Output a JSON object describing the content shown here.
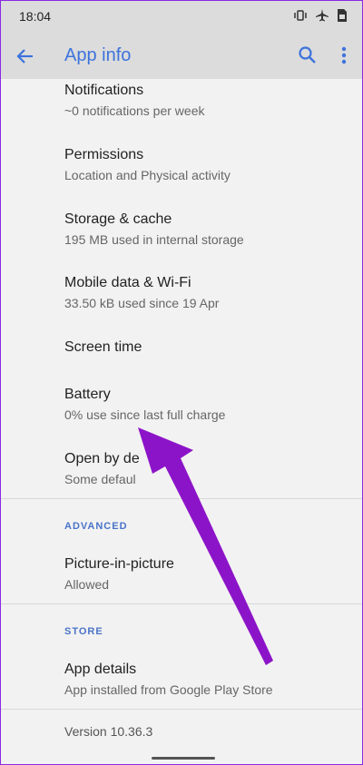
{
  "status_bar": {
    "time": "18:04",
    "icons": [
      "vibrate-icon",
      "airplane-mode-icon",
      "sim-icon"
    ]
  },
  "app_bar": {
    "title": "App info",
    "back_icon": "back-arrow-icon",
    "search_icon": "search-icon",
    "more_icon": "more-vert-icon"
  },
  "items": [
    {
      "title": "Notifications",
      "subtitle": "~0 notifications per week"
    },
    {
      "title": "Permissions",
      "subtitle": "Location and Physical activity"
    },
    {
      "title": "Storage & cache",
      "subtitle": "195 MB used in internal storage"
    },
    {
      "title": "Mobile data & Wi-Fi",
      "subtitle": "33.50 kB used since 19 Apr"
    },
    {
      "title": "Screen time",
      "subtitle": ""
    },
    {
      "title": "Battery",
      "subtitle": "0% use since last full charge"
    },
    {
      "title": "Open by de",
      "subtitle": "Some defaul"
    }
  ],
  "sections": {
    "advanced": {
      "label": "ADVANCED",
      "items": [
        {
          "title": "Picture-in-picture",
          "subtitle": "Allowed"
        }
      ]
    },
    "store": {
      "label": "STORE",
      "items": [
        {
          "title": "App details",
          "subtitle": "App installed from Google Play Store"
        }
      ]
    }
  },
  "footer": {
    "version": "Version 10.36.3"
  },
  "colors": {
    "accent": "#3d73db",
    "annotation": "#8c14c8",
    "header_bg": "#dcdcdc",
    "background": "#f2f2f2"
  }
}
